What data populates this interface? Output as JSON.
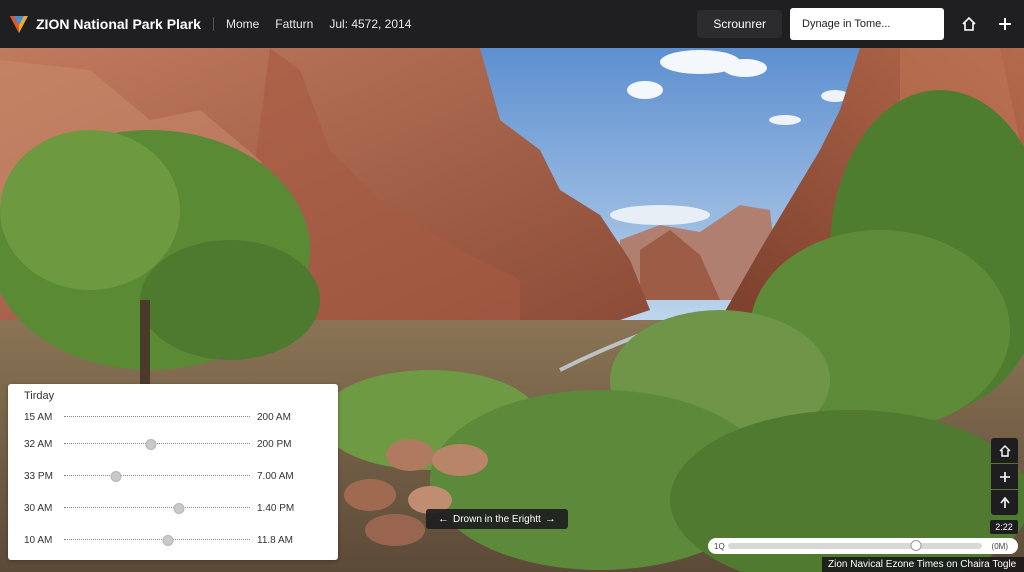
{
  "header": {
    "brand": "ZION National Park Plark",
    "nav": [
      "Mome",
      "Fatturn"
    ],
    "date": "Jul: 4572, 2014",
    "action_button": "Scrounrer",
    "search_value": "Dynage in Tome...",
    "icons": [
      "home-icon",
      "plus-icon"
    ]
  },
  "time_panel": {
    "title": "Tirday",
    "rows": [
      {
        "start": "15 AM",
        "end": "200 AM",
        "level": null
      },
      {
        "start": "32 AM",
        "end": "200 PM",
        "level": 0.47
      },
      {
        "start": "33 PM",
        "end": "7.00 AM",
        "level": 0.28
      },
      {
        "start": "30 AM",
        "end": "1.40 PM",
        "level": 0.62
      },
      {
        "start": "10 AM",
        "end": "11.8 AM",
        "level": 0.56
      }
    ]
  },
  "tooltip": {
    "label": "Drown in the Erightt"
  },
  "controls": {
    "icons": [
      "home-icon",
      "plus-icon",
      "arrow-up-icon"
    ],
    "time_badge": "2:22"
  },
  "timeline": {
    "start_label": "1Q",
    "end_label": "(0M)",
    "progress": 0.74
  },
  "footer": {
    "caption": "Zion Navical Ezone Times on Chaira Togle"
  },
  "colors": {
    "topbar": "#1f1f22",
    "panel": "#ffffff",
    "sky": "#8fb6e0",
    "rock": "#a8614a",
    "foliage": "#5f8a3a"
  }
}
